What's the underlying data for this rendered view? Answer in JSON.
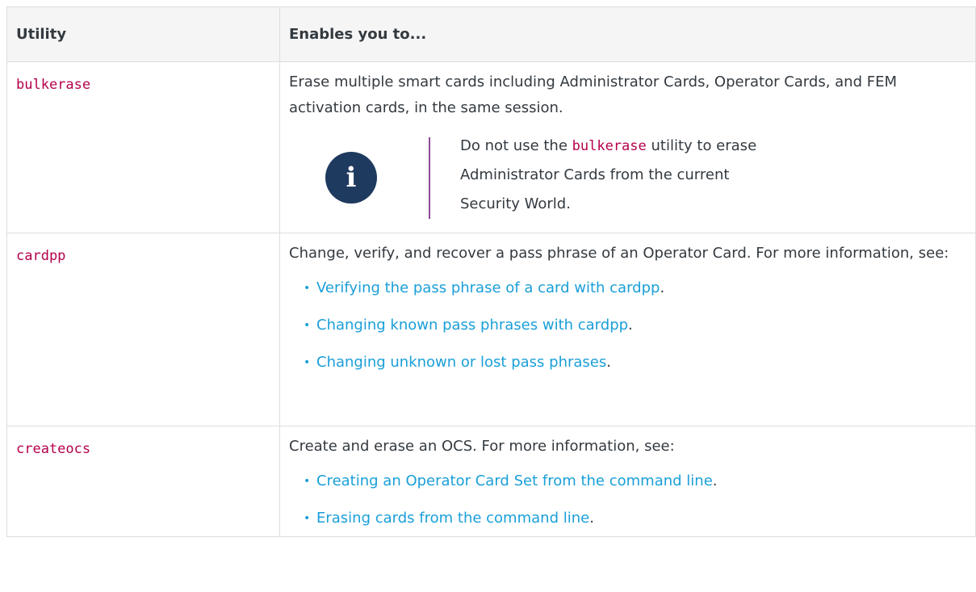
{
  "table": {
    "headers": {
      "utility": "Utility",
      "enables": "Enables you to..."
    },
    "rows": [
      {
        "utility": "bulkerase",
        "description": "Erase multiple smart cards including Administrator Cards, Operator Cards, and FEM activation cards, in the same session.",
        "note": {
          "icon": "info-icon",
          "before": "Do not use the ",
          "code": "bulkerase",
          "after": " utility to erase Administrator Cards from the current Security World."
        }
      },
      {
        "utility": "cardpp",
        "description": "Change, verify, and recover a pass phrase of an Operator Card. For more information, see:",
        "links": [
          "Verifying the pass phrase of a card with cardpp",
          "Changing known pass phrases with cardpp",
          "Changing unknown or lost pass phrases"
        ]
      },
      {
        "utility": "createocs",
        "description": "Create and erase an OCS. For more information, see:",
        "links": [
          "Creating an Operator Card Set from the command line",
          "Erasing cards from the command line"
        ]
      }
    ]
  },
  "colors": {
    "code": "#b5004c",
    "link": "#1a9fd8",
    "note_bar": "#8f4a97",
    "info_icon_bg": "#1f3a5f",
    "header_bg": "#f5f5f5"
  }
}
